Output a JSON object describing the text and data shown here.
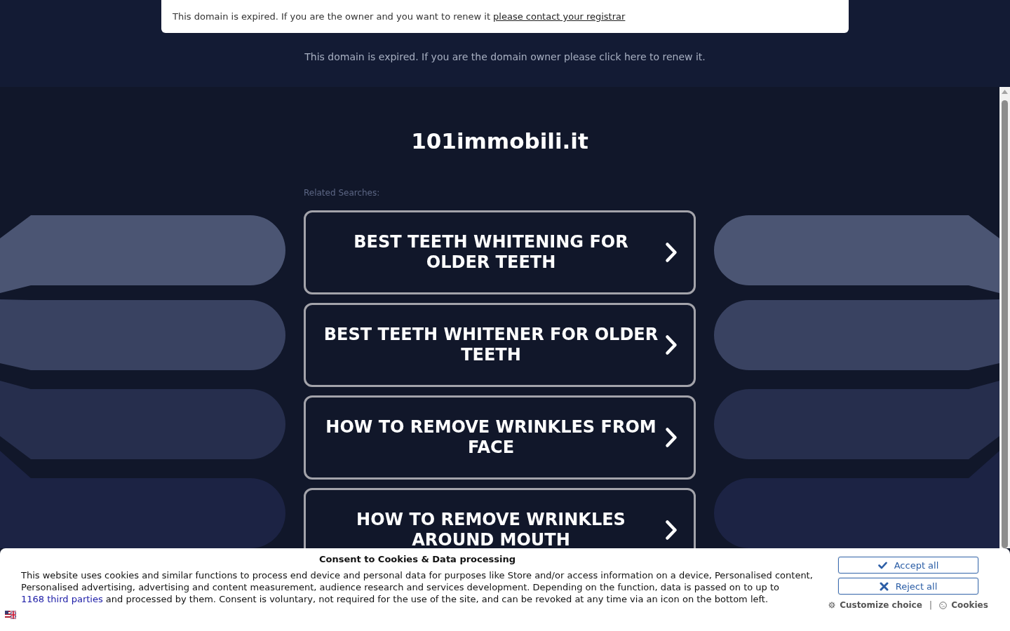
{
  "expiry_notice": {
    "text": "This domain is expired. If you are the owner and you want to renew it",
    "link": "please contact your registrar"
  },
  "renew_message": "This domain is expired. If you are the domain owner please click here to renew it.",
  "site_title": "101immobili.it",
  "related_searches": {
    "label": "Related Searches:",
    "items": [
      "BEST TEETH WHITENING FOR OLDER TEETH",
      "BEST TEETH WHITENER FOR OLDER TEETH",
      "HOW TO REMOVE WRINKLES FROM FACE",
      "HOW TO REMOVE WRINKLES AROUND MOUTH"
    ]
  },
  "cookie_consent": {
    "title": "Consent to Cookies & Data processing",
    "text_before": "This website uses cookies and similar functions to process end device and personal data for purposes like Store and/or access information on a device, Personalised content, Personalised advertising, advertising and content measurement, audience research and services development. Depending on the function, data is passed on to up to",
    "link": "1168 third parties",
    "text_after": "and processed by them. Consent is voluntary, not required for the use of the site, and can be revoked at any time via an icon on the bottom left.",
    "buttons": [
      {
        "kind": "accept",
        "label": "Accept all"
      },
      {
        "kind": "reject",
        "label": "Reject all"
      }
    ],
    "links": [
      {
        "kind": "customize",
        "label": "Customize choice"
      },
      {
        "kind": "cookies",
        "label": "Cookies"
      }
    ],
    "separator": "|"
  }
}
